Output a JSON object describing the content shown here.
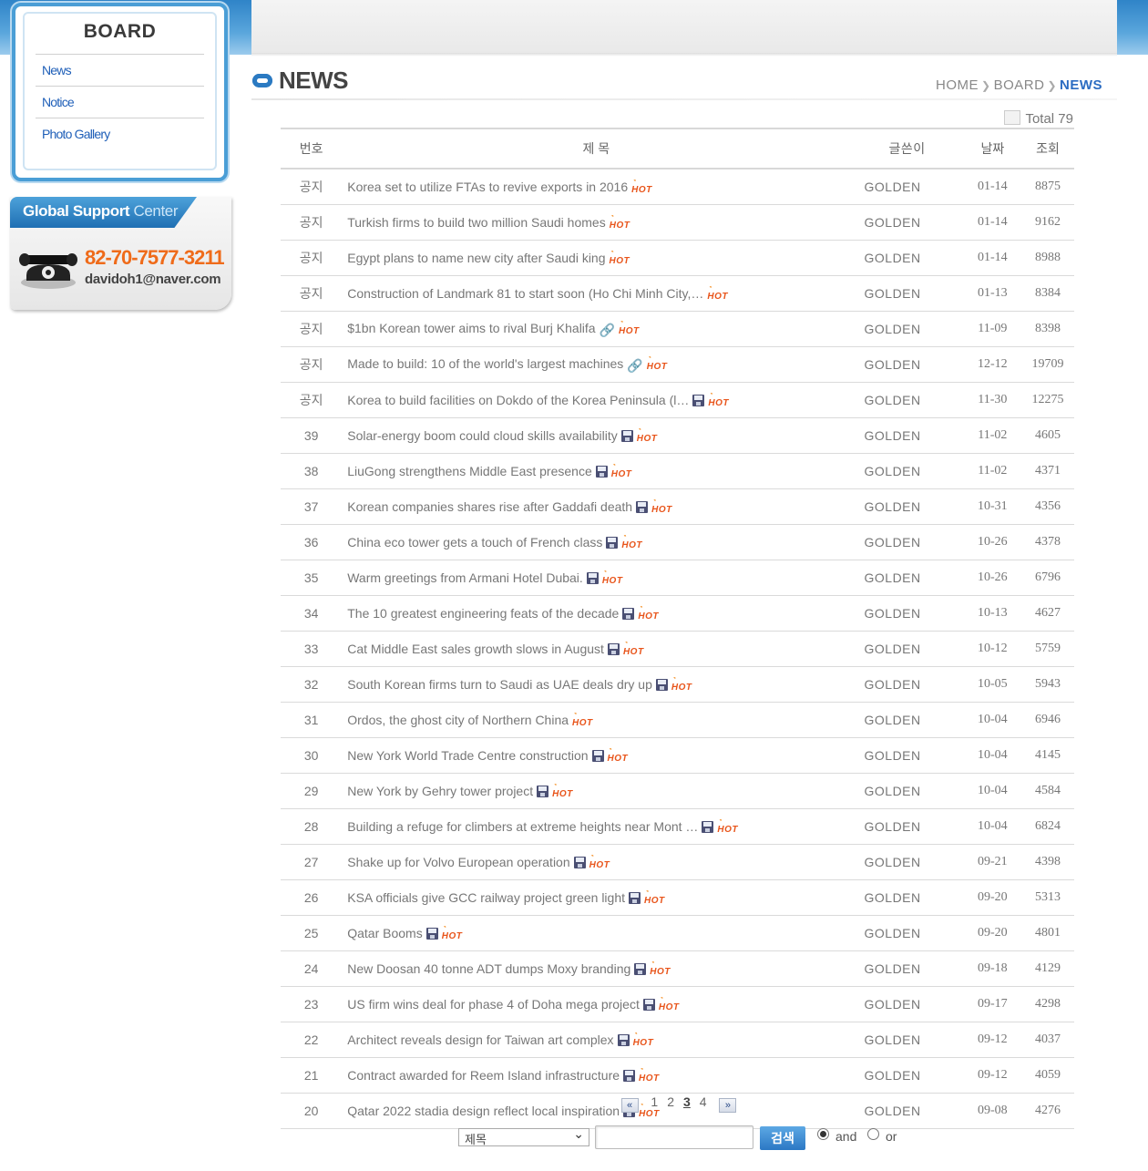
{
  "sidebar": {
    "board_title": "BOARD",
    "links": [
      "News",
      "Notice",
      "Photo Gallery"
    ],
    "support_title_main": "Global Support",
    "support_title_sub": "Center",
    "support_phone": "82-70-7577-3211",
    "support_email": "davidoh1@naver.com"
  },
  "header": {
    "title": "NEWS",
    "breadcrumb": [
      "HOME",
      "BOARD",
      "NEWS"
    ],
    "total": "Total 79"
  },
  "table": {
    "headers": {
      "num": "번호",
      "title": "제      목",
      "writer": "글쓴이",
      "date": "날짜",
      "views": "조회"
    },
    "rows": [
      {
        "num": "공지",
        "title": "Korea set to utilize FTAs to revive exports in 2016",
        "icon": "",
        "writer": "GOLDEN",
        "date": "01-14",
        "views": "8875"
      },
      {
        "num": "공지",
        "title": "Turkish firms to build two million Saudi homes",
        "icon": "",
        "writer": "GOLDEN",
        "date": "01-14",
        "views": "9162"
      },
      {
        "num": "공지",
        "title": "Egypt plans to name new city after Saudi king",
        "icon": "",
        "writer": "GOLDEN",
        "date": "01-14",
        "views": "8988"
      },
      {
        "num": "공지",
        "title": "Construction of Landmark 81 to start soon (Ho Chi Minh City,…",
        "icon": "",
        "writer": "GOLDEN",
        "date": "01-13",
        "views": "8384"
      },
      {
        "num": "공지",
        "title": "$1bn Korean tower aims to rival Burj Khalifa",
        "icon": "link",
        "writer": "GOLDEN",
        "date": "11-09",
        "views": "8398"
      },
      {
        "num": "공지",
        "title": "Made to build: 10 of the world's largest machines",
        "icon": "link",
        "writer": "GOLDEN",
        "date": "12-12",
        "views": "19709"
      },
      {
        "num": "공지",
        "title": "Korea to build facilities on Dokdo of the Korea Peninsula (l…",
        "icon": "disk",
        "writer": "GOLDEN",
        "date": "11-30",
        "views": "12275"
      },
      {
        "num": "39",
        "title": "Solar-energy boom could cloud skills availability",
        "icon": "disk",
        "writer": "GOLDEN",
        "date": "11-02",
        "views": "4605"
      },
      {
        "num": "38",
        "title": "LiuGong strengthens Middle East presence",
        "icon": "disk",
        "writer": "GOLDEN",
        "date": "11-02",
        "views": "4371"
      },
      {
        "num": "37",
        "title": "Korean companies shares rise after Gaddafi death",
        "icon": "disk",
        "writer": "GOLDEN",
        "date": "10-31",
        "views": "4356"
      },
      {
        "num": "36",
        "title": "China eco tower gets a touch of French class",
        "icon": "disk",
        "writer": "GOLDEN",
        "date": "10-26",
        "views": "4378"
      },
      {
        "num": "35",
        "title": "Warm greetings from Armani Hotel Dubai.",
        "icon": "disk",
        "writer": "GOLDEN",
        "date": "10-26",
        "views": "6796"
      },
      {
        "num": "34",
        "title": "The 10 greatest engineering feats of the decade",
        "icon": "disk",
        "writer": "GOLDEN",
        "date": "10-13",
        "views": "4627"
      },
      {
        "num": "33",
        "title": "Cat Middle East sales growth slows in August",
        "icon": "disk",
        "writer": "GOLDEN",
        "date": "10-12",
        "views": "5759"
      },
      {
        "num": "32",
        "title": "South Korean firms turn to Saudi as UAE deals dry up",
        "icon": "disk",
        "writer": "GOLDEN",
        "date": "10-05",
        "views": "5943"
      },
      {
        "num": "31",
        "title": "Ordos, the ghost city of Northern China",
        "icon": "",
        "writer": "GOLDEN",
        "date": "10-04",
        "views": "6946"
      },
      {
        "num": "30",
        "title": "New York World Trade Centre construction",
        "icon": "disk",
        "writer": "GOLDEN",
        "date": "10-04",
        "views": "4145"
      },
      {
        "num": "29",
        "title": "New York by Gehry tower project",
        "icon": "disk",
        "writer": "GOLDEN",
        "date": "10-04",
        "views": "4584"
      },
      {
        "num": "28",
        "title": "Building a refuge for climbers at extreme heights near Mont …",
        "icon": "disk",
        "writer": "GOLDEN",
        "date": "10-04",
        "views": "6824"
      },
      {
        "num": "27",
        "title": "Shake up for Volvo European operation",
        "icon": "disk",
        "writer": "GOLDEN",
        "date": "09-21",
        "views": "4398"
      },
      {
        "num": "26",
        "title": "KSA officials give GCC railway project green light",
        "icon": "disk",
        "writer": "GOLDEN",
        "date": "09-20",
        "views": "5313"
      },
      {
        "num": "25",
        "title": "Qatar Booms",
        "icon": "disk",
        "writer": "GOLDEN",
        "date": "09-20",
        "views": "4801"
      },
      {
        "num": "24",
        "title": "New Doosan 40 tonne ADT dumps Moxy branding",
        "icon": "disk",
        "writer": "GOLDEN",
        "date": "09-18",
        "views": "4129"
      },
      {
        "num": "23",
        "title": "US firm wins deal for phase 4 of Doha mega project",
        "icon": "disk",
        "writer": "GOLDEN",
        "date": "09-17",
        "views": "4298"
      },
      {
        "num": "22",
        "title": "Architect reveals design for Taiwan art complex",
        "icon": "disk",
        "writer": "GOLDEN",
        "date": "09-12",
        "views": "4037"
      },
      {
        "num": "21",
        "title": "Contract awarded for Reem Island infrastructure",
        "icon": "disk",
        "writer": "GOLDEN",
        "date": "09-12",
        "views": "4059"
      },
      {
        "num": "20",
        "title": "Qatar 2022 stadia design reflect local inspiration",
        "icon": "disk",
        "writer": "GOLDEN",
        "date": "09-08",
        "views": "4276"
      }
    ],
    "hot_label": "HOT"
  },
  "pager": {
    "prev": "«",
    "next": "»",
    "pages": [
      "1",
      "2",
      "3",
      "4"
    ],
    "current": "3"
  },
  "search": {
    "field_selected": "제목",
    "input_value": "",
    "button": "검색",
    "radio_and": "and",
    "radio_or": "or",
    "selected_mode": "and"
  }
}
